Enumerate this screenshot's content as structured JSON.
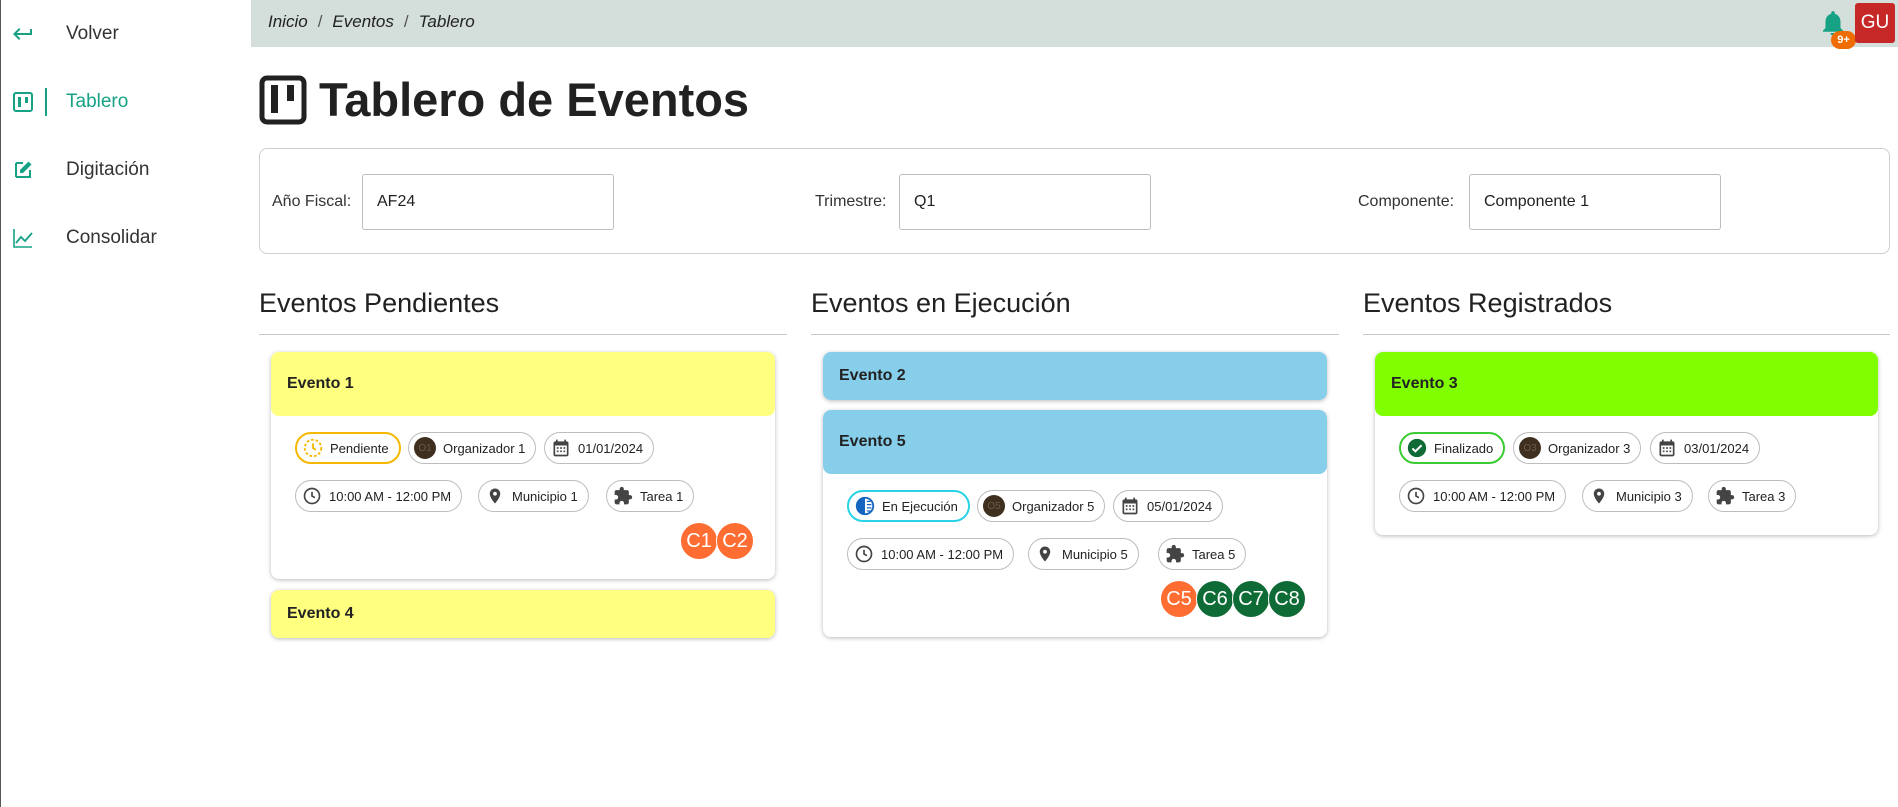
{
  "sidebar": {
    "items": [
      {
        "label": "Volver",
        "icon": "return-arrow-icon"
      },
      {
        "label": "Tablero",
        "icon": "board-icon",
        "active": true
      },
      {
        "label": "Digitación",
        "icon": "edit-icon"
      },
      {
        "label": "Consolidar",
        "icon": "chart-line-icon"
      }
    ]
  },
  "breadcrumb": [
    "Inicio",
    "Eventos",
    "Tablero"
  ],
  "breadcrumb_sep": "/",
  "header": {
    "notifications_badge": "9+",
    "avatar_initials": "GU"
  },
  "page_title": "Tablero de Eventos",
  "filters": {
    "fiscal_year_label": "Año Fiscal:",
    "fiscal_year_value": "AF24",
    "quarter_label": "Trimestre:",
    "quarter_value": "Q1",
    "component_label": "Componente:",
    "component_value": "Componente 1"
  },
  "columns": [
    {
      "title": "Eventos Pendientes",
      "color": "#ffff80",
      "cards": [
        {
          "title": "Evento 1",
          "status": "Pendiente",
          "organizer": "Organizador 1",
          "org_initials": "O1",
          "date": "01/01/2024",
          "time": "10:00 AM - 12:00 PM",
          "municipio": "Municipio 1",
          "task": "Tarea 1",
          "circles": [
            "C1",
            "C2"
          ]
        },
        {
          "title": "Evento 4"
        }
      ]
    },
    {
      "title": "Eventos en Ejecución",
      "color": "#87ceeb",
      "cards": [
        {
          "title": "Evento 2"
        },
        {
          "title": "Evento 5",
          "status": "En Ejecución",
          "organizer": "Organizador 5",
          "org_initials": "O5",
          "date": "05/01/2024",
          "time": "10:00 AM - 12:00 PM",
          "municipio": "Municipio 5",
          "task": "Tarea 5",
          "circles": [
            "C5",
            "C6",
            "C7",
            "C8"
          ]
        }
      ]
    },
    {
      "title": "Eventos Registrados",
      "color": "#80ff00",
      "cards": [
        {
          "title": "Evento 3",
          "status": "Finalizado",
          "organizer": "Organizador 3",
          "org_initials": "O3",
          "date": "03/01/2024",
          "time": "10:00 AM - 12:00 PM",
          "municipio": "Municipio 3",
          "task": "Tarea 3"
        }
      ]
    }
  ],
  "colors": {
    "accent": "#17a285",
    "circle_orange": "#ff6d33",
    "circle_green": "#0e6b35",
    "pending_border": "#f5b800",
    "running_border": "#29d3e6",
    "done_border": "#3acc32"
  }
}
